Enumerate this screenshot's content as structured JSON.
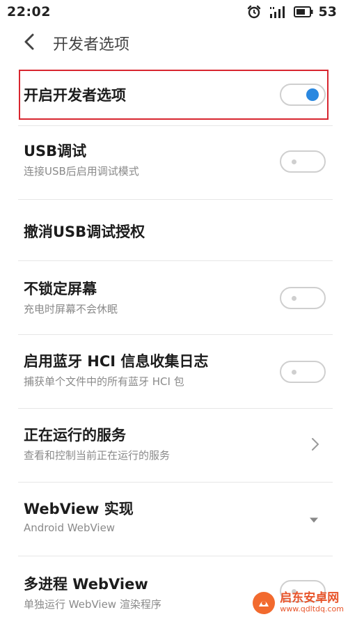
{
  "status_bar": {
    "time": "22:02",
    "battery": "53",
    "icons": [
      "alarm-icon",
      "signal-icon",
      "battery-icon"
    ]
  },
  "header": {
    "back_icon": "chevron-left-icon",
    "title": "开发者选项"
  },
  "settings": [
    {
      "id": "enable-dev-options",
      "title": "开启开发者选项",
      "subtitle": "",
      "control": "toggle",
      "enabled": true
    },
    {
      "id": "usb-debugging",
      "title": "USB调试",
      "subtitle": "连接USB后启用调试模式",
      "control": "toggle",
      "enabled": false
    },
    {
      "id": "revoke-usb-auth",
      "title": "撤消USB调试授权",
      "subtitle": "",
      "control": "none"
    },
    {
      "id": "stay-awake",
      "title": "不锁定屏幕",
      "subtitle": "充电时屏幕不会休眠",
      "control": "toggle",
      "enabled": false
    },
    {
      "id": "bluetooth-hci-log",
      "title": "启用蓝牙 HCI 信息收集日志",
      "subtitle": "捕获单个文件中的所有蓝牙 HCI 包",
      "control": "toggle",
      "enabled": false
    },
    {
      "id": "running-services",
      "title": "正在运行的服务",
      "subtitle": "查看和控制当前正在运行的服务",
      "control": "chevron"
    },
    {
      "id": "webview-impl",
      "title": "WebView 实现",
      "subtitle": "Android WebView",
      "control": "dropdown"
    },
    {
      "id": "multiprocess-webview",
      "title": "多进程 WebView",
      "subtitle": "单独运行 WebView 渲染程序",
      "control": "toggle",
      "enabled": false
    }
  ],
  "watermark": {
    "name": "启东安卓网",
    "url": "www.qdltdq.com"
  },
  "colors": {
    "accent": "#2a88e0",
    "highlight": "#d8262f",
    "toggle_off": "#cfcfcf",
    "subtitle": "#8a8a8a",
    "watermark": "#e8542a"
  }
}
